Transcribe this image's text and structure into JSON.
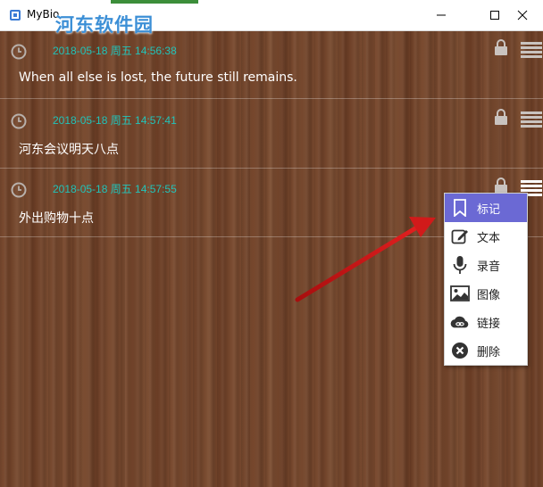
{
  "window": {
    "title": "MyBio",
    "watermark": "河东软件园",
    "controls": [
      "minimize",
      "maximize",
      "close"
    ]
  },
  "notes": [
    {
      "timestamp": "2018-05-18 周五 14:56:38",
      "text": "When all else is lost, the future still remains."
    },
    {
      "timestamp": "2018-05-18 周五 14:57:41",
      "text": "河东会议明天八点"
    },
    {
      "timestamp": "2018-05-18 周五 14:57:55",
      "text": "外出购物十点"
    }
  ],
  "context_menu": {
    "items": [
      {
        "label": "标记",
        "icon": "bookmark-icon",
        "active": true
      },
      {
        "label": "文本",
        "icon": "edit-icon",
        "active": false
      },
      {
        "label": "录音",
        "icon": "microphone-icon",
        "active": false
      },
      {
        "label": "图像",
        "icon": "image-icon",
        "active": false
      },
      {
        "label": "链接",
        "icon": "cloud-link-icon",
        "active": false
      },
      {
        "label": "删除",
        "icon": "delete-icon",
        "active": false
      }
    ]
  },
  "colors": {
    "timestamp": "#21c3b9",
    "menu_highlight": "#6b69d4",
    "arrow": "#d11a1a"
  }
}
